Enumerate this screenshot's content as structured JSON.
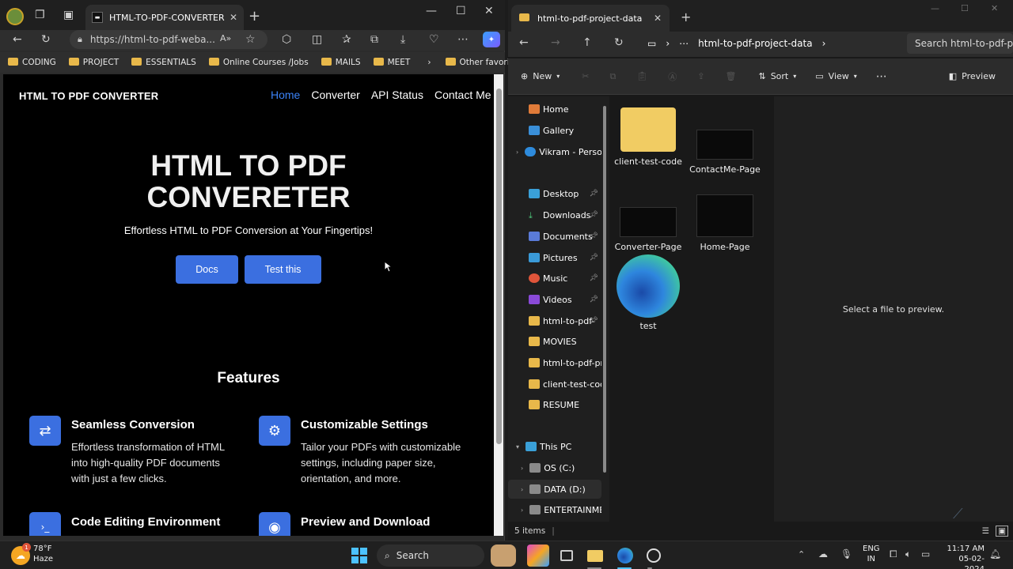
{
  "browser": {
    "tab_title": "HTML-TO-PDF-CONVERTER",
    "url": "https://html-to-pdf-weba...",
    "favorites": [
      "CODING",
      "PROJECT",
      "ESSENTIALS",
      "Online Courses /Jobs",
      "MAILS",
      "MEET"
    ],
    "other_favorites": "Other favorites"
  },
  "site": {
    "brand": "HTML TO PDF CONVERTER",
    "nav": [
      "Home",
      "Converter",
      "API Status",
      "Contact Me"
    ],
    "hero_title_1": "HTML TO PDF",
    "hero_title_2": "CONVERETER",
    "hero_sub": "Effortless HTML to PDF Conversion at Your Fingertips!",
    "btn_docs": "Docs",
    "btn_test": "Test this",
    "features_title": "Features",
    "features": [
      {
        "title": "Seamless Conversion",
        "desc_1": "Effortless transformation of HTML",
        "desc_2": "into high-quality PDF documents",
        "desc_3": "with just a few clicks.",
        "icon": "⇄"
      },
      {
        "title": "Customizable Settings",
        "desc_1": "Tailor your PDFs with customizable",
        "desc_2": "settings, including paper size,",
        "desc_3": "orientation, and more.",
        "icon": "⚙"
      },
      {
        "title": "Code Editing Environment",
        "icon": "›_"
      },
      {
        "title": "Preview and Download",
        "icon": "◉"
      }
    ]
  },
  "explorer": {
    "tab_title": "html-to-pdf-project-data",
    "path": "html-to-pdf-project-data",
    "search_placeholder": "Search html-to-pdf-proj",
    "cmd": {
      "new": "New",
      "sort": "Sort",
      "view": "View",
      "preview": "Preview"
    },
    "sidebar": [
      "Home",
      "Gallery",
      "Vikram - Persona",
      "Desktop",
      "Downloads",
      "Documents",
      "Pictures",
      "Music",
      "Videos",
      "html-to-pdf-",
      "MOVIES",
      "html-to-pdf-prc",
      "client-test-code",
      "RESUME",
      "This PC",
      "OS (C:)",
      "DATA (D:)",
      "ENTERTAINME"
    ],
    "files": [
      "client-test-code",
      "ContactMe-Page",
      "Converter-Page",
      "Home-Page",
      "test"
    ],
    "preview_text": "Select a file to preview.",
    "status": "5 items"
  },
  "taskbar": {
    "weather_temp": "78°F",
    "weather_desc": "Haze",
    "weather_badge": "1",
    "search": "Search",
    "lang_1": "ENG",
    "lang_2": "IN",
    "time": "11:17 AM",
    "date": "05-02-2024"
  }
}
